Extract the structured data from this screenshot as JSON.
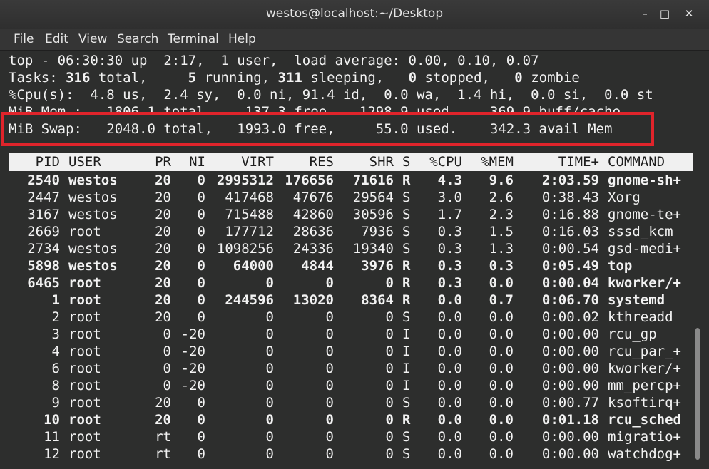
{
  "window": {
    "title": "westos@localhost:~/Desktop",
    "minimize_glyph": "–",
    "maximize_glyph": "□",
    "close_glyph": "✕"
  },
  "menu": [
    "File",
    "Edit",
    "View",
    "Search",
    "Terminal",
    "Help"
  ],
  "summary": {
    "line1": "top - 06:30:30 up  2:17,  1 user,  load average: 0.00, 0.10, 0.07",
    "line2_label": "Tasks:",
    "line2_total": " 316",
    "line2_total_text": " total,   ",
    "line2_running": "  5",
    "line2_running_text": " running, ",
    "line2_sleeping": "311",
    "line2_sleeping_text": " sleeping,   ",
    "line2_stopped": "0",
    "line2_stopped_text": " stopped,   ",
    "line2_zombie": "0",
    "line2_zombie_text": " zombie",
    "line3": "%Cpu(s):  4.8 us,  2.4 sy,  0.0 ni, 91.4 id,  0.0 wa,  1.4 hi,  0.0 si,  0.0 st",
    "line4": "MiB Mem :   1806.1 total,    137.3 free,   1298.9 used,    369.9 buff/cache",
    "line5": "MiB Swap:   2048.0 total,   1993.0 free,     55.0 used.    342.3 avail Mem"
  },
  "table": {
    "headers": [
      "PID",
      "USER",
      "PR",
      "NI",
      "VIRT",
      "RES",
      "SHR",
      "S",
      "%CPU",
      "%MEM",
      "TIME+",
      "COMMAND"
    ],
    "rows": [
      {
        "bold": true,
        "cells": [
          "2540",
          "westos",
          "20",
          "0",
          "2995312",
          "176656",
          "71616",
          "R",
          "4.3",
          "9.6",
          "2:03.59",
          "gnome-sh+"
        ]
      },
      {
        "bold": false,
        "cells": [
          "2447",
          "westos",
          "20",
          "0",
          "417468",
          "47676",
          "29564",
          "S",
          "3.0",
          "2.6",
          "0:38.43",
          "Xorg"
        ]
      },
      {
        "bold": false,
        "cells": [
          "3167",
          "westos",
          "20",
          "0",
          "715488",
          "42860",
          "30596",
          "S",
          "1.7",
          "2.3",
          "0:16.88",
          "gnome-te+"
        ]
      },
      {
        "bold": false,
        "cells": [
          "2669",
          "root",
          "20",
          "0",
          "177712",
          "28636",
          "7936",
          "S",
          "0.3",
          "1.5",
          "0:16.03",
          "sssd_kcm"
        ]
      },
      {
        "bold": false,
        "cells": [
          "2734",
          "westos",
          "20",
          "0",
          "1098256",
          "24336",
          "19340",
          "S",
          "0.3",
          "1.3",
          "0:00.54",
          "gsd-medi+"
        ]
      },
      {
        "bold": true,
        "cells": [
          "5898",
          "westos",
          "20",
          "0",
          "64000",
          "4844",
          "3976",
          "R",
          "0.3",
          "0.3",
          "0:05.49",
          "top"
        ]
      },
      {
        "bold": true,
        "cells": [
          "6465",
          "root",
          "20",
          "0",
          "0",
          "0",
          "0",
          "R",
          "0.3",
          "0.0",
          "0:00.04",
          "kworker/+"
        ]
      },
      {
        "bold": true,
        "cells": [
          "1",
          "root",
          "20",
          "0",
          "244596",
          "13020",
          "8364",
          "R",
          "0.0",
          "0.7",
          "0:06.70",
          "systemd"
        ]
      },
      {
        "bold": false,
        "cells": [
          "2",
          "root",
          "20",
          "0",
          "0",
          "0",
          "0",
          "S",
          "0.0",
          "0.0",
          "0:00.02",
          "kthreadd"
        ]
      },
      {
        "bold": false,
        "cells": [
          "3",
          "root",
          "0",
          "-20",
          "0",
          "0",
          "0",
          "I",
          "0.0",
          "0.0",
          "0:00.00",
          "rcu_gp"
        ]
      },
      {
        "bold": false,
        "cells": [
          "4",
          "root",
          "0",
          "-20",
          "0",
          "0",
          "0",
          "I",
          "0.0",
          "0.0",
          "0:00.00",
          "rcu_par_+"
        ]
      },
      {
        "bold": false,
        "cells": [
          "6",
          "root",
          "0",
          "-20",
          "0",
          "0",
          "0",
          "I",
          "0.0",
          "0.0",
          "0:00.00",
          "kworker/+"
        ]
      },
      {
        "bold": false,
        "cells": [
          "8",
          "root",
          "0",
          "-20",
          "0",
          "0",
          "0",
          "I",
          "0.0",
          "0.0",
          "0:00.00",
          "mm_percp+"
        ]
      },
      {
        "bold": false,
        "cells": [
          "9",
          "root",
          "20",
          "0",
          "0",
          "0",
          "0",
          "S",
          "0.0",
          "0.0",
          "0:00.77",
          "ksoftirq+"
        ]
      },
      {
        "bold": true,
        "cells": [
          "10",
          "root",
          "20",
          "0",
          "0",
          "0",
          "0",
          "R",
          "0.0",
          "0.0",
          "0:01.18",
          "rcu_sched"
        ]
      },
      {
        "bold": false,
        "cells": [
          "11",
          "root",
          "rt",
          "0",
          "0",
          "0",
          "0",
          "S",
          "0.0",
          "0.0",
          "0:00.00",
          "migratio+"
        ]
      },
      {
        "bold": false,
        "cells": [
          "12",
          "root",
          "rt",
          "0",
          "0",
          "0",
          "0",
          "S",
          "0.0",
          "0.0",
          "0:00.00",
          "watchdog+"
        ]
      }
    ]
  },
  "colors": {
    "highlight_border": "#e0242b",
    "terminal_bg": "#2d2e2d",
    "header_bg": "#f0f0f0"
  }
}
